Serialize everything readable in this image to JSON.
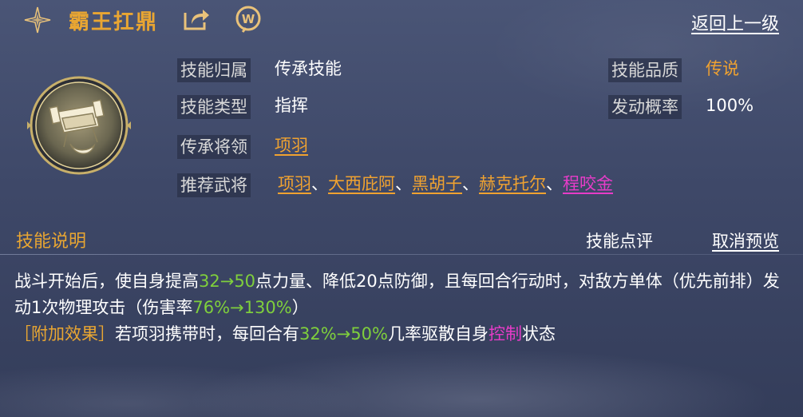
{
  "header": {
    "title": "霸王扛鼎",
    "back_label": "返回上一级"
  },
  "icons": {
    "star": "four-point-star-icon",
    "share": "share-icon",
    "wiki": "wiki-icon",
    "emblem": "cauldron-skill-icon"
  },
  "colors": {
    "accent_gold": "#f0a230",
    "highlight_green": "#7fcf3c",
    "highlight_magenta": "#e63cc8"
  },
  "attributes": {
    "origin": {
      "label": "技能归属",
      "value": "传承技能"
    },
    "quality": {
      "label": "技能品质",
      "value": "传说"
    },
    "type": {
      "label": "技能类型",
      "value": "指挥"
    },
    "trigger_rate": {
      "label": "发动概率",
      "value": "100%"
    },
    "inherit_general": {
      "label": "传承将领",
      "value": "项羽"
    },
    "recommended": {
      "label": "推荐武将",
      "generals": [
        "项羽",
        "大西庇阿",
        "黑胡子",
        "赫克托尔",
        "程咬金"
      ],
      "separator": "、"
    }
  },
  "section": {
    "title": "技能说明",
    "review_label": "技能点评",
    "cancel_preview_label": "取消预览"
  },
  "description": {
    "line1_a": "战斗开始后，使自身提高",
    "line1_b": "32→50",
    "line1_c": "点力量、降低20点防御，且每回合行动时，对敌方单体（优先前排）发动1次物理攻击（伤害率",
    "line1_d": "76%→130%",
    "line1_e": "）",
    "line2_bracket": "［附加效果］",
    "line2_a": "若项羽携带时，每回合有",
    "line2_b": "32%→50%",
    "line2_c": "几率驱散自身",
    "line2_d": "控制",
    "line2_e": "状态"
  }
}
